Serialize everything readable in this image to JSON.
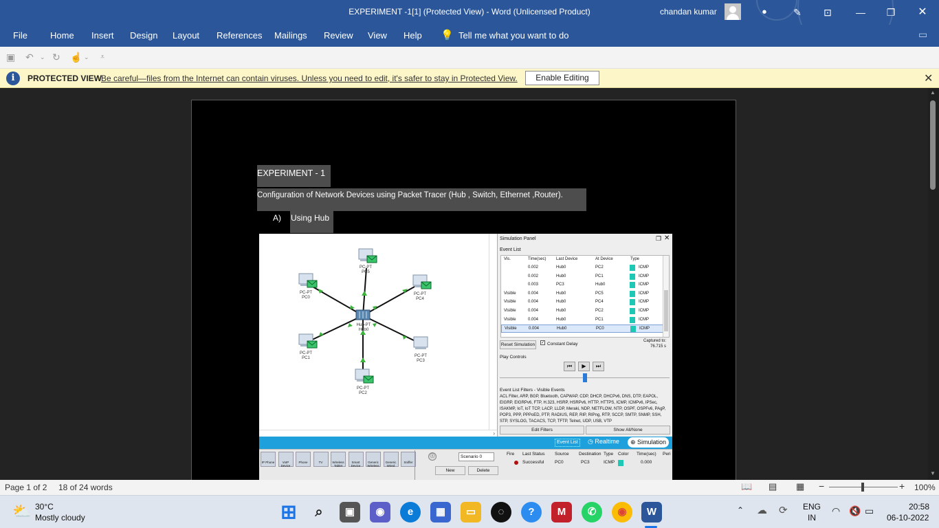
{
  "titlebar": {
    "title": "EXPERIMENT -1[1] (Protected View)  -  Word (Unlicensed Product)",
    "user": "chandan kumar"
  },
  "menu": {
    "items": [
      "File",
      "Home",
      "Insert",
      "Design",
      "Layout",
      "References",
      "Mailings",
      "Review",
      "View",
      "Help"
    ],
    "tell_me": "Tell me what you want to do"
  },
  "protected_view": {
    "title": "PROTECTED VIEW",
    "message": "Be careful—files from the Internet can contain viruses. Unless you need to edit, it's safer to stay in Protected View.",
    "button": "Enable Editing"
  },
  "document": {
    "heading": "EXPERIMENT -  1",
    "subtitle": "Configuration of Network Devices using Packet Tracer (Hub , Switch, Ethernet ,Router).",
    "list_marker": "A)",
    "list_item": "Using Hub"
  },
  "packet_tracer": {
    "devices": [
      {
        "type": "PC-PT",
        "name": "PC5"
      },
      {
        "type": "PC-PT",
        "name": "PC0"
      },
      {
        "type": "PC-PT",
        "name": "PC4"
      },
      {
        "type": "Hub-PT",
        "name": "Hub0"
      },
      {
        "type": "PC-PT",
        "name": "PC1"
      },
      {
        "type": "PC-PT",
        "name": "PC3"
      },
      {
        "type": "PC-PT",
        "name": "PC2"
      }
    ],
    "sim_panel_title": "Simulation Panel",
    "event_list_label": "Event List",
    "event_columns": [
      "Vis.",
      "Time(sec)",
      "Last Device",
      "At Device",
      "Type"
    ],
    "events": [
      {
        "vis": "",
        "time": "0.002",
        "last": "Hub0",
        "at": "PC2",
        "type": "ICMP"
      },
      {
        "vis": "",
        "time": "0.002",
        "last": "Hub0",
        "at": "PC1",
        "type": "ICMP"
      },
      {
        "vis": "",
        "time": "0.003",
        "last": "PC3",
        "at": "Hub0",
        "type": "ICMP"
      },
      {
        "vis": "Visible",
        "time": "0.004",
        "last": "Hub0",
        "at": "PC5",
        "type": "ICMP"
      },
      {
        "vis": "Visible",
        "time": "0.004",
        "last": "Hub0",
        "at": "PC4",
        "type": "ICMP"
      },
      {
        "vis": "Visible",
        "time": "0.004",
        "last": "Hub0",
        "at": "PC2",
        "type": "ICMP"
      },
      {
        "vis": "Visible",
        "time": "0.004",
        "last": "Hub0",
        "at": "PC1",
        "type": "ICMP"
      },
      {
        "vis": "Visible",
        "time": "0.004",
        "last": "Hub0",
        "at": "PC0",
        "type": "ICMP"
      }
    ],
    "reset_btn": "Reset Simulation",
    "constant_delay": "Constant Delay",
    "captured_to_label": "Captured to:",
    "captured_to_value": "76.715 s",
    "play_controls": "Play Controls",
    "filters_title": "Event List Filters - Visible Events",
    "filters_text": "ACL Filter, ARP, BGP, Bluetooth, CAPWAP, CDP, DHCP, DHCPv6, DNS, DTP, EAPOL, EIGRP, EIGRPv6, FTP, H.323, HSRP, HSRPv6, HTTP, HTTPS, ICMP, ICMPv6, IPSec, ISAKMP, IoT, IoT TCP, LACP, LLDP, Meraki, NDP, NETFLOW, NTP, OSPF, OSPFv6, PAgP, POP3, PPP, PPPoED, PTP, RADIUS, REP, RIP, RIPng, RTP, SCCP, SMTP, SNMP, SSH, STP, SYSLOG, TACACS, TCP, TFTP, Telnet, UDP, USB, VTP",
    "edit_filters": "Edit Filters",
    "show_all": "Show All/None",
    "mode_event_list": "Event List",
    "mode_realtime": "Realtime",
    "mode_simulation": "Simulation",
    "dev_palette": [
      "IP Phone",
      "VoIP Device",
      "Phone",
      "TV",
      "Wireless Tablet",
      "Smart Device",
      "Generic Wireless",
      "Generic Wired",
      "Sniffer"
    ],
    "scenario": "Scenario 0",
    "new_btn": "New",
    "delete_btn": "Delete",
    "pdu_columns": [
      "Fire",
      "Last Status",
      "Source",
      "Destination",
      "Type",
      "Color",
      "Time(sec)",
      "Peri"
    ],
    "pdu_row": {
      "status": "Successful",
      "source": "PC0",
      "dest": "PC3",
      "type": "ICMP",
      "time": "0.000"
    }
  },
  "statusbar": {
    "page": "Page 1 of 2",
    "words": "18 of 24 words",
    "zoom": "100%"
  },
  "taskbar": {
    "temp": "30°C",
    "weather": "Mostly cloudy",
    "lang1": "ENG",
    "lang2": "IN",
    "time": "20:58",
    "date": "06-10-2022"
  },
  "colors": {
    "word_blue": "#2b579a",
    "pv_yellow": "#fcf6c8",
    "icmp_teal": "#1ec8b4",
    "pt_blue": "#1ea0dc"
  }
}
